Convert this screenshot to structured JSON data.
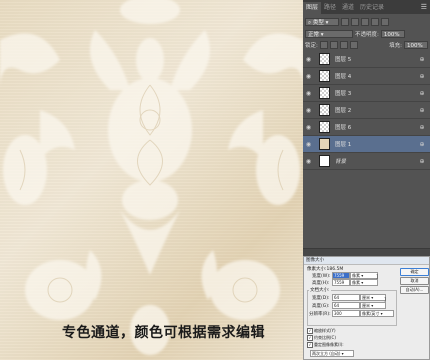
{
  "canvas": {
    "caption": "专色通道，颜色可根据需求编辑"
  },
  "layers_panel": {
    "tabs": [
      "图层",
      "路径",
      "通道",
      "历史记录"
    ],
    "active_tab": 0,
    "kind_label": "类型",
    "blend_mode": "正常",
    "opacity_label": "不透明度:",
    "opacity_value": "100%",
    "lock_label": "锁定:",
    "fill_label": "填充:",
    "fill_value": "100%",
    "layers": [
      {
        "name": "图层 5",
        "thumb": "transparent",
        "selected": false,
        "italic": false
      },
      {
        "name": "图层 4",
        "thumb": "transparent",
        "selected": false,
        "italic": false
      },
      {
        "name": "图层 3",
        "thumb": "transparent",
        "selected": false,
        "italic": false
      },
      {
        "name": "图层 2",
        "thumb": "transparent",
        "selected": false,
        "italic": false
      },
      {
        "name": "图层 6",
        "thumb": "transparent",
        "selected": false,
        "italic": false
      },
      {
        "name": "图层 1",
        "thumb": "art",
        "selected": true,
        "italic": false
      },
      {
        "name": "背景",
        "thumb": "white",
        "selected": false,
        "italic": true
      }
    ]
  },
  "image_size_dialog": {
    "title": "图像大小",
    "pixel_size": "像素大小:186.5M",
    "width_label": "宽度(W):",
    "width_value": "7559",
    "height_label": "高度(H):",
    "height_value": "7559",
    "pixel_unit": "像素",
    "doc_size_label": "文档大小:",
    "doc_width_label": "宽度(D):",
    "doc_width_value": "64",
    "doc_height_label": "高度(G):",
    "doc_height_value": "64",
    "cm_unit": "厘米",
    "resolution_label": "分辨率(R):",
    "resolution_value": "300",
    "resolution_unit": "像素/英寸",
    "ok": "确定",
    "cancel": "取消",
    "auto": "自动(A)...",
    "check_scale_styles": "缩放样式(Y)",
    "check_constrain": "约束比例(C)",
    "check_resample": "重定图像像素(I):",
    "resample_method": "两次立方 (自动)"
  },
  "colors": {
    "panel_bg": "#535353",
    "selected_layer": "#5a6f8f",
    "artwork_base": "#ede3cf"
  }
}
